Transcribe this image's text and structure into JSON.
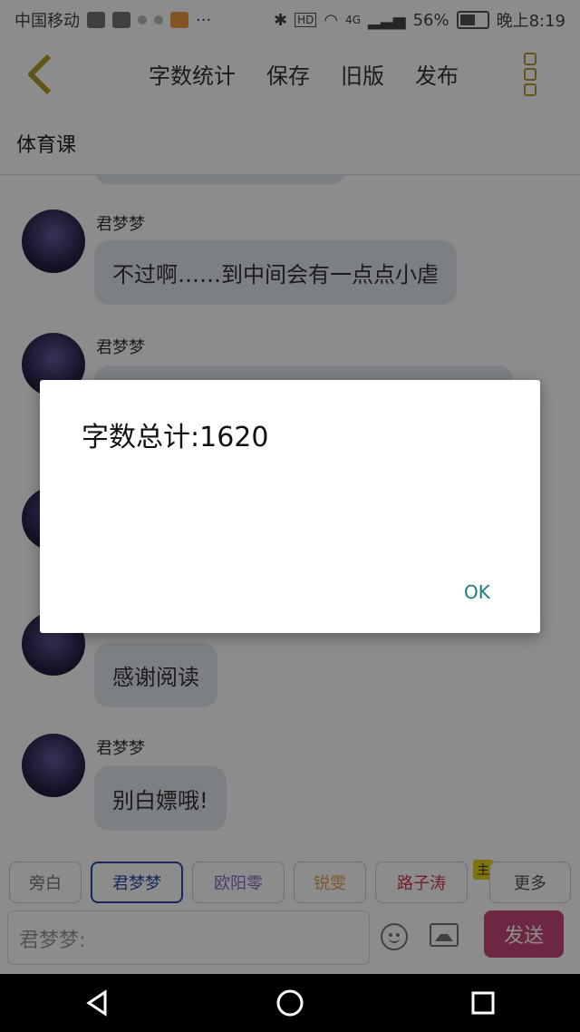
{
  "status_bar": {
    "carrier": "中国移动",
    "battery_percent": "56%",
    "time": "晚上8:19",
    "network": "4G",
    "hd": "HD"
  },
  "toolbar": {
    "menu": [
      "字数统计",
      "保存",
      "旧版",
      "发布"
    ]
  },
  "title": "体育课",
  "messages": [
    {
      "name": "君梦梦",
      "text": "不过啊……到中间会有一点点小虐"
    },
    {
      "name": "君梦梦",
      "text": ""
    },
    {
      "name": "",
      "text": ""
    },
    {
      "name": "",
      "text": "感谢阅读"
    },
    {
      "name": "君梦梦",
      "text": "别白嫖哦!"
    }
  ],
  "roles": [
    {
      "label": "旁白",
      "color": "#777777"
    },
    {
      "label": "君梦梦",
      "color": "#2a4aa2"
    },
    {
      "label": "欧阳零",
      "color": "#8a6bbf"
    },
    {
      "label": "锐雯",
      "color": "#e0a055"
    },
    {
      "label": "路子涛",
      "color": "#d03a4a"
    },
    {
      "label": "更多",
      "color": "#555555"
    }
  ],
  "role_badge": "主",
  "input": {
    "placeholder": "君梦梦:"
  },
  "send_label": "发送",
  "dialog": {
    "message": "字数总计:1620",
    "ok_label": "OK"
  },
  "colors": {
    "accent_gold": "#b59a2a",
    "send_pink": "#c8487a",
    "ok_teal": "#17807a"
  }
}
